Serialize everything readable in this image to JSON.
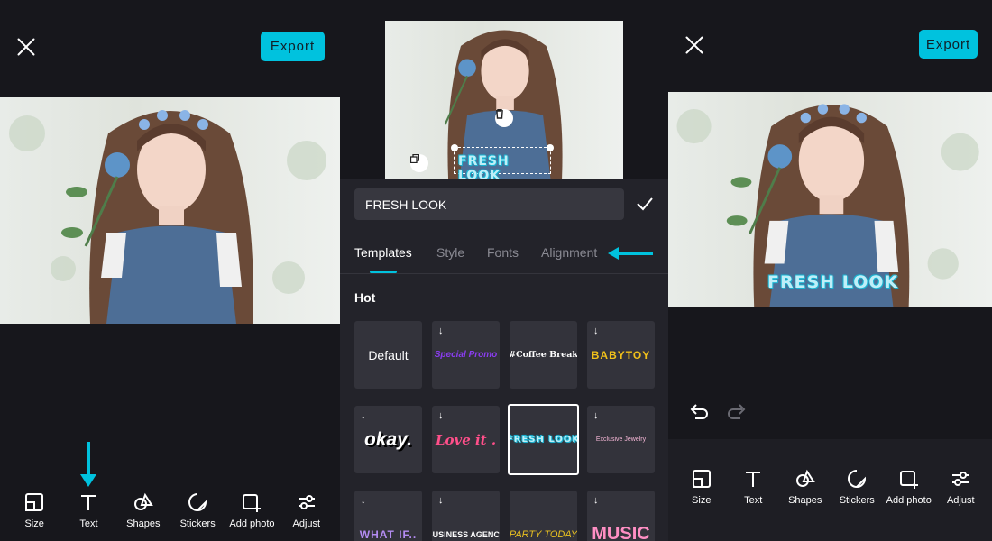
{
  "panel_edit": {
    "export_label": "Export",
    "toolbar": [
      {
        "label": "Size",
        "icon": "size-icon"
      },
      {
        "label": "Text",
        "icon": "text-icon"
      },
      {
        "label": "Shapes",
        "icon": "shapes-icon"
      },
      {
        "label": "Stickers",
        "icon": "stickers-icon"
      },
      {
        "label": "Add photo",
        "icon": "add-photo-icon"
      },
      {
        "label": "Adjust",
        "icon": "adjust-icon"
      }
    ]
  },
  "panel_text": {
    "overlay_text": "FRESH LOOK",
    "input_value": "FRESH LOOK",
    "tabs": [
      {
        "label": "Templates"
      },
      {
        "label": "Style"
      },
      {
        "label": "Fonts"
      },
      {
        "label": "Alignment"
      }
    ],
    "section_title": "Hot",
    "templates": [
      {
        "label": "Default"
      },
      {
        "label": "Special Promo"
      },
      {
        "label": "#Coffee Break"
      },
      {
        "label": "BABYTOY"
      },
      {
        "label": "okay."
      },
      {
        "label": "Love it ."
      },
      {
        "label": "FRESH LOOK"
      },
      {
        "label": "Exclusive Jewelry"
      },
      {
        "label": "WHAT IF.."
      },
      {
        "label": "BUSINESS AGENCY"
      },
      {
        "label": "PARTY TODAY"
      },
      {
        "label": "MUSIC"
      }
    ],
    "download_glyph": "↓"
  },
  "panel_result": {
    "export_label": "Export",
    "overlay_text": "FRESH LOOK",
    "toolbar": [
      {
        "label": "Size",
        "icon": "size-icon"
      },
      {
        "label": "Text",
        "icon": "text-icon"
      },
      {
        "label": "Shapes",
        "icon": "shapes-icon"
      },
      {
        "label": "Stickers",
        "icon": "stickers-icon"
      },
      {
        "label": "Add photo",
        "icon": "add-photo-icon"
      },
      {
        "label": "Adjust",
        "icon": "adjust-icon"
      }
    ]
  },
  "colors": {
    "accent": "#00c2de",
    "background": "#17171c",
    "sheet": "#23232a",
    "tile": "#33333b"
  }
}
